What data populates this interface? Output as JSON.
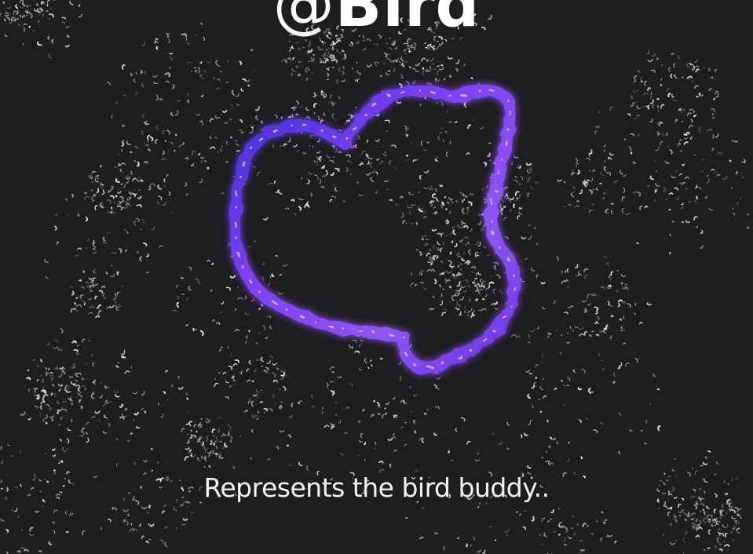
{
  "header": {
    "at_symbol": "@",
    "title_word": "Bird"
  },
  "caption": {
    "text": "Represents the bird buddy.."
  },
  "icon": {
    "name": "bird-buddy-icon",
    "accent": "#7b3ff2",
    "accent_light": "#a98cf7",
    "accent_deep": "#3a2fd8"
  },
  "colors": {
    "background": "#1e1d1f",
    "sparkle": "#e8e8ea",
    "text": "#ffffff"
  }
}
